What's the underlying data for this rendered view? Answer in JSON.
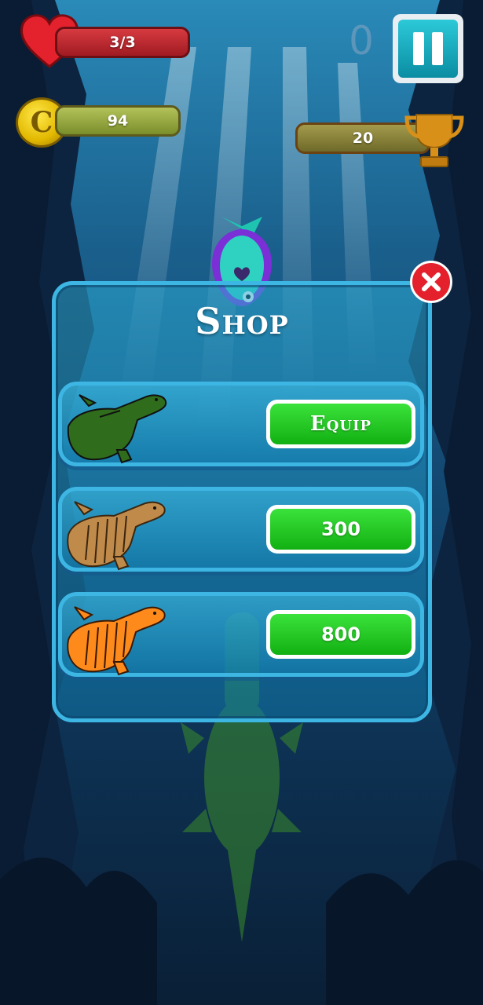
{
  "hud": {
    "health": "3/3",
    "coins": "94",
    "best_score": "20",
    "current_score": "0"
  },
  "shop": {
    "title": "Shop",
    "items": [
      {
        "skin": "green-crocodile",
        "button_label": "Equip",
        "color": "#2f6d1c"
      },
      {
        "skin": "tan-crocodile",
        "button_label": "300",
        "color": "#c08a4a"
      },
      {
        "skin": "orange-crocodile",
        "button_label": "800",
        "color": "#ff8a1c"
      }
    ]
  },
  "colors": {
    "accent": "#3db6e4",
    "button_green": "#1fc41f",
    "close_red": "#e3202c",
    "health_red": "#c52a31"
  }
}
